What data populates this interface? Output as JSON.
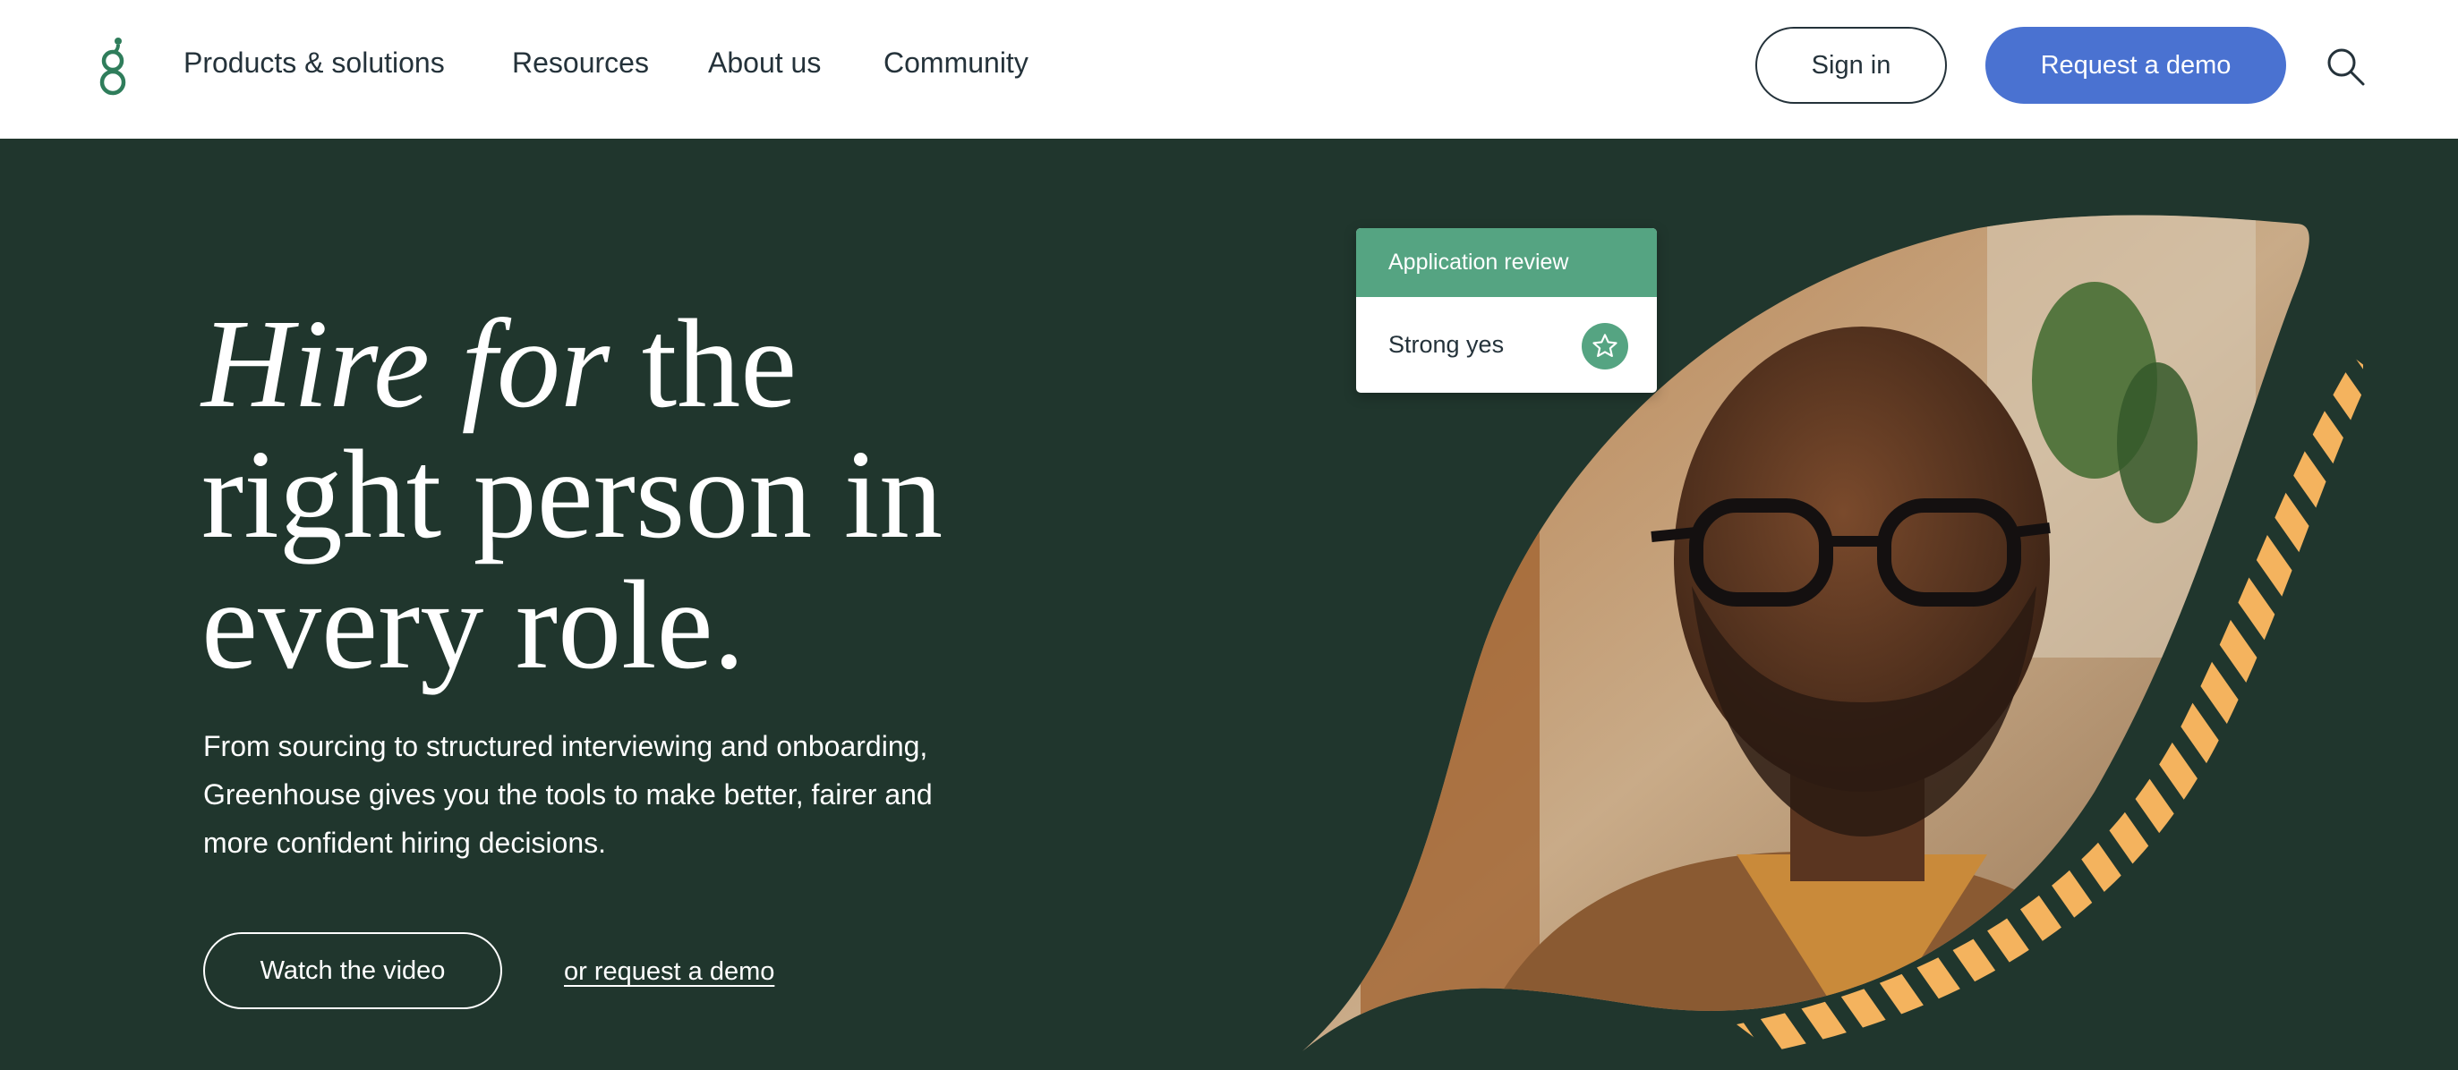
{
  "nav": {
    "logo_icon": "greenhouse-logo-icon",
    "links": [
      "Products & solutions",
      "Resources",
      "About us",
      "Community"
    ],
    "sign_in_label": "Sign in",
    "request_demo_label": "Request a demo",
    "search_icon": "search-icon"
  },
  "hero": {
    "headline_italic": "Hire for",
    "headline_rest_1": " the",
    "headline_line_2": "right person in",
    "headline_line_3": "every role.",
    "description": "From sourcing to structured interviewing and onboarding, Greenhouse gives you the tools to make better, fairer and more confident hiring decisions.",
    "watch_video_label": "Watch the video",
    "request_demo_link": "or request a demo",
    "image_subject": "portrait photo of a smiling bearded man with glasses",
    "card": {
      "title": "Application review",
      "rating": "Strong yes",
      "rating_icon": "star-icon"
    }
  },
  "colors": {
    "hero_bg": "#20362d",
    "brand_green": "#55a482",
    "primary_button": "#4a72d1",
    "accent_orange": "#f4b35e",
    "text_dark": "#24323a"
  }
}
